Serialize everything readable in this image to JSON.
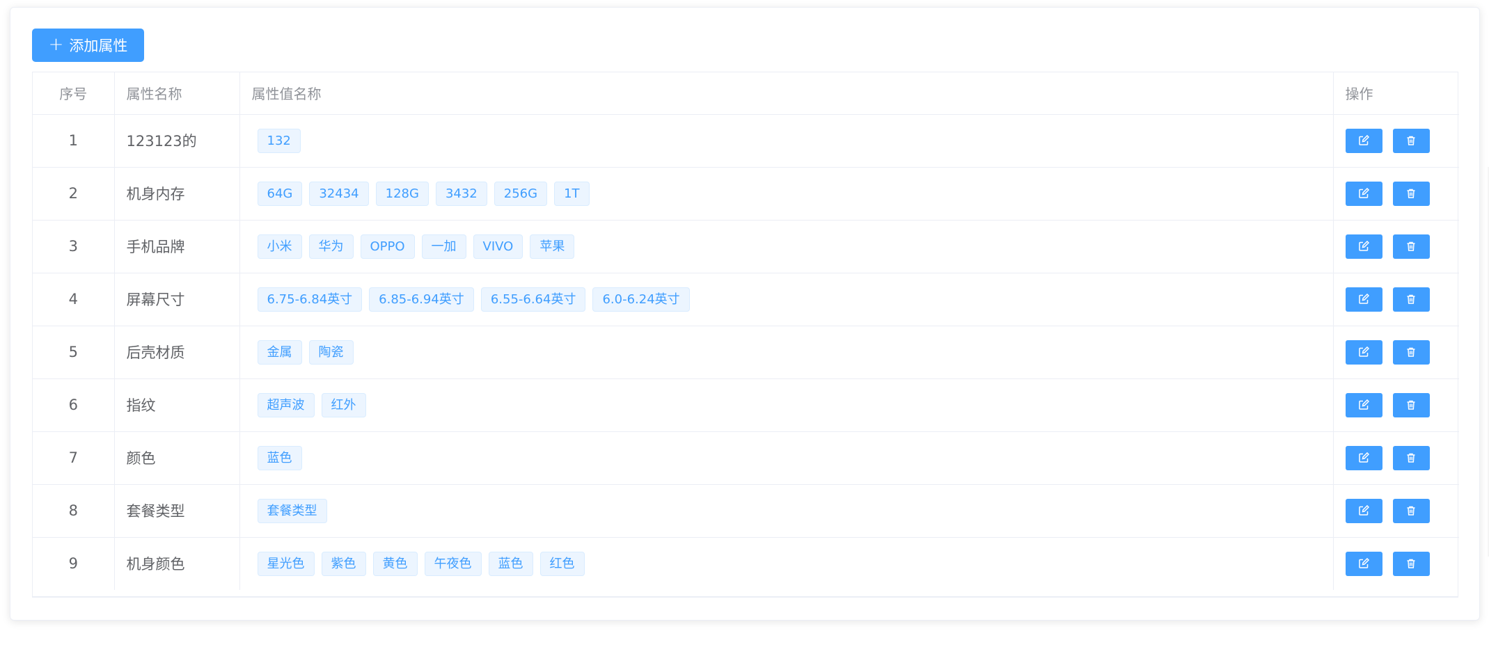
{
  "toolbar": {
    "add_label": "添加属性",
    "add_icon": "plus-icon"
  },
  "table": {
    "headers": {
      "index": "序号",
      "name": "属性名称",
      "values": "属性值名称",
      "actions": "操作"
    },
    "rows": [
      {
        "index": "1",
        "name": "123123的",
        "values": [
          "132"
        ]
      },
      {
        "index": "2",
        "name": "机身内存",
        "values": [
          "64G",
          "32434",
          "128G",
          "3432",
          "256G",
          "1T"
        ]
      },
      {
        "index": "3",
        "name": "手机品牌",
        "values": [
          "小米",
          "华为",
          "OPPO",
          "一加",
          "VIVO",
          "苹果"
        ]
      },
      {
        "index": "4",
        "name": "屏幕尺寸",
        "values": [
          "6.75-6.84英寸",
          "6.85-6.94英寸",
          "6.55-6.64英寸",
          "6.0-6.24英寸"
        ]
      },
      {
        "index": "5",
        "name": "后壳材质",
        "values": [
          "金属",
          "陶瓷"
        ]
      },
      {
        "index": "6",
        "name": "指纹",
        "values": [
          "超声波",
          "红外"
        ]
      },
      {
        "index": "7",
        "name": "颜色",
        "values": [
          "蓝色"
        ]
      },
      {
        "index": "8",
        "name": "套餐类型",
        "values": [
          "套餐类型"
        ]
      },
      {
        "index": "9",
        "name": "机身颜色",
        "values": [
          "星光色",
          "紫色",
          "黄色",
          "午夜色",
          "蓝色",
          "红色"
        ]
      }
    ],
    "row_actions": {
      "edit_icon": "edit-icon",
      "delete_icon": "trash-icon"
    }
  },
  "colors": {
    "primary": "#409eff",
    "tag_bg": "#ecf5ff",
    "tag_border": "#d9ecff",
    "header_text": "#909399",
    "body_text": "#606266",
    "border": "#ebeef5"
  }
}
